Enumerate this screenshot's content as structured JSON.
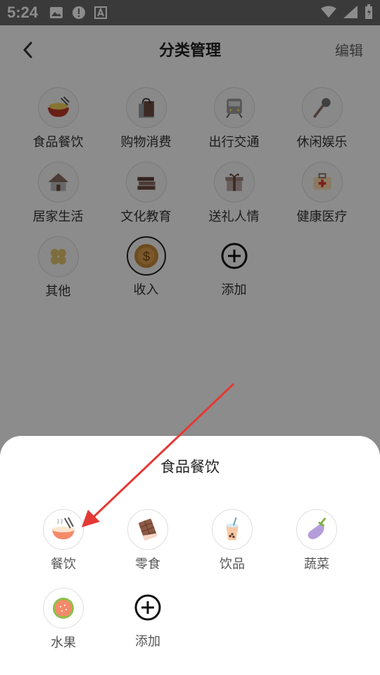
{
  "status_bar": {
    "time": "5:24",
    "icons": [
      "image-icon",
      "alert-icon",
      "a-icon",
      "wifi-icon",
      "signal-icon",
      "battery-icon"
    ]
  },
  "header": {
    "title": "分类管理",
    "edit_label": "编辑"
  },
  "categories": [
    {
      "label": "食品餐饮",
      "icon": "food-bowl-icon"
    },
    {
      "label": "购物消费",
      "icon": "shopping-bag-icon"
    },
    {
      "label": "出行交通",
      "icon": "train-icon"
    },
    {
      "label": "休闲娱乐",
      "icon": "microphone-icon"
    },
    {
      "label": "居家生活",
      "icon": "house-icon"
    },
    {
      "label": "文化教育",
      "icon": "books-icon"
    },
    {
      "label": "送礼人情",
      "icon": "gift-icon"
    },
    {
      "label": "健康医疗",
      "icon": "medical-kit-icon"
    },
    {
      "label": "其他",
      "icon": "clover-icon"
    },
    {
      "label": "收入",
      "icon": "coin-icon"
    },
    {
      "label": "添加",
      "icon": "add-circle-icon"
    }
  ],
  "sheet": {
    "title": "食品餐饮",
    "items": [
      {
        "label": "餐饮",
        "icon": "noodle-bowl-icon"
      },
      {
        "label": "零食",
        "icon": "chocolate-icon"
      },
      {
        "label": "饮品",
        "icon": "bubble-tea-icon"
      },
      {
        "label": "蔬菜",
        "icon": "eggplant-icon"
      },
      {
        "label": "水果",
        "icon": "guava-icon"
      },
      {
        "label": "添加",
        "icon": "add-circle-icon"
      }
    ]
  },
  "colors": {
    "overlay": "#000000",
    "annotation_arrow": "#e53935",
    "coin": "#c98a3a"
  }
}
